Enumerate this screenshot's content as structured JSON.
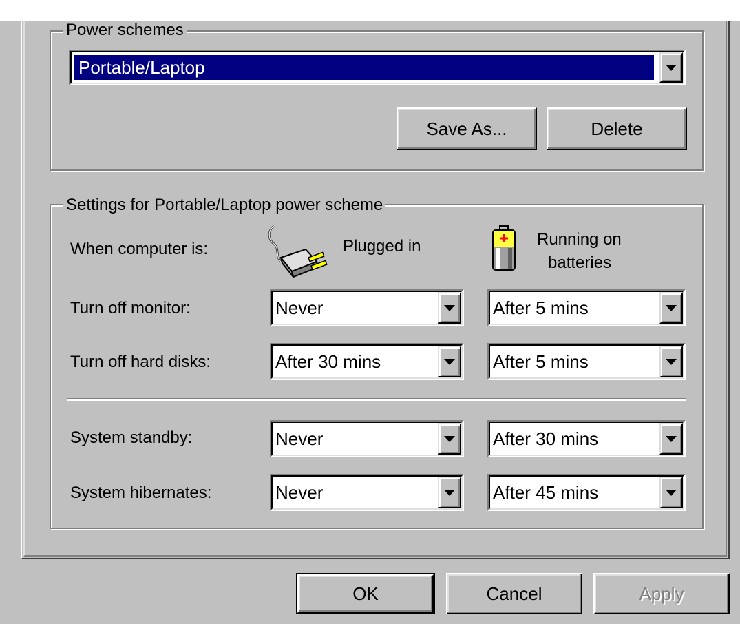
{
  "power_schemes": {
    "group_label": "Power schemes",
    "selected_scheme": "Portable/Laptop",
    "save_as_label": "Save As...",
    "delete_label": "Delete"
  },
  "settings": {
    "group_label": "Settings for Portable/Laptop power scheme",
    "when_label": "When computer is:",
    "plugged_in_label": "Plugged in",
    "batteries_line1": "Running on",
    "batteries_line2": "batteries",
    "rows": [
      {
        "label": "Turn off monitor:",
        "plugged": "Never",
        "battery": "After 5 mins"
      },
      {
        "label": "Turn off hard disks:",
        "plugged": "After 30 mins",
        "battery": "After 5 mins"
      },
      {
        "label": "System standby:",
        "plugged": "Never",
        "battery": "After 30 mins"
      },
      {
        "label": "System hibernates:",
        "plugged": "Never",
        "battery": "After 45 mins"
      }
    ]
  },
  "footer": {
    "ok_label": "OK",
    "cancel_label": "Cancel",
    "apply_label": "Apply"
  },
  "icons": {
    "plug": "power-plug-icon",
    "battery": "battery-icon",
    "dropdown": "chevron-down-icon"
  },
  "colors": {
    "face": "#c0c0c0",
    "selection": "#000080"
  }
}
